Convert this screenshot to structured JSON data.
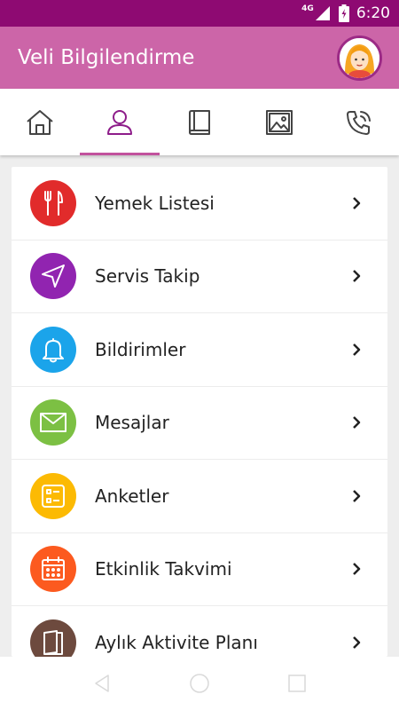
{
  "status_bar": {
    "network": "4G",
    "time": "6:20"
  },
  "app_bar": {
    "title": "Veli Bilgilendirme"
  },
  "tabs": [
    {
      "icon": "home-icon"
    },
    {
      "icon": "profile-icon",
      "active": true
    },
    {
      "icon": "book-icon"
    },
    {
      "icon": "gallery-icon"
    },
    {
      "icon": "phone-icon"
    }
  ],
  "menu": {
    "items": [
      {
        "label": "Yemek Listesi",
        "icon": "fork-knife-icon",
        "color": "#e12b2b"
      },
      {
        "label": "Servis Takip",
        "icon": "navigation-arrow-icon",
        "color": "#9124b0"
      },
      {
        "label": "Bildirimler",
        "icon": "bell-icon",
        "color": "#1ba4ea"
      },
      {
        "label": "Mesajlar",
        "icon": "envelope-icon",
        "color": "#7cc043"
      },
      {
        "label": "Anketler",
        "icon": "survey-list-icon",
        "color": "#fcba03"
      },
      {
        "label": "Etkinlik Takvimi",
        "icon": "calendar-icon",
        "color": "#fc5a1f"
      },
      {
        "label": "Aylık Aktivite Planı",
        "icon": "book-plan-icon",
        "color": "#6d4a3e"
      }
    ]
  },
  "colors": {
    "status_bar": "#8e0a72",
    "app_bar": "#cc65a8",
    "accent": "#c2529d"
  }
}
